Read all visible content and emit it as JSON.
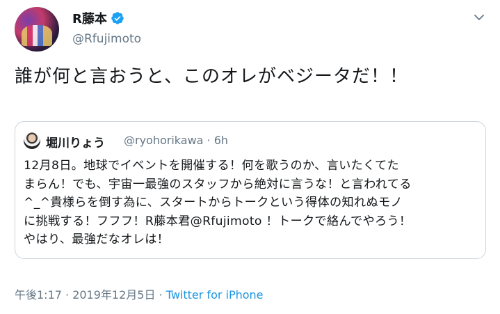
{
  "author": {
    "display_name": "R藤本",
    "handle": "@Rfujimoto"
  },
  "tweet": {
    "text": "誰が何と言おうと、このオレがベジータだ！！"
  },
  "quoted_tweet": {
    "display_name": "堀川りょう",
    "meta": "@ryohorikawa · 6h",
    "lines": [
      "12月8日。地球でイベントを開催する！何を歌うのか、言いたくてた",
      "まらん！でも、宇宙一最強のスタッフから絶対に言うな！と言われてる",
      "^_^貴様らを倒す為に、スタートからトークという得体の知れぬモノ",
      "に挑戦する！フフフ！R藤本君@Rfujimoto ！トークで絡んでやろう！",
      "やはり、最強だなオレは！"
    ]
  },
  "footer": {
    "timestamp": "午後1:17 · 2019年12月5日 · ",
    "source": "Twitter for iPhone"
  },
  "colors": {
    "verified_blue": "#1da1f2",
    "link_blue": "#1b95e0",
    "secondary_gray": "#657786"
  },
  "icons": {
    "verified": "verified-badge-icon",
    "menu": "chevron-down-icon"
  }
}
